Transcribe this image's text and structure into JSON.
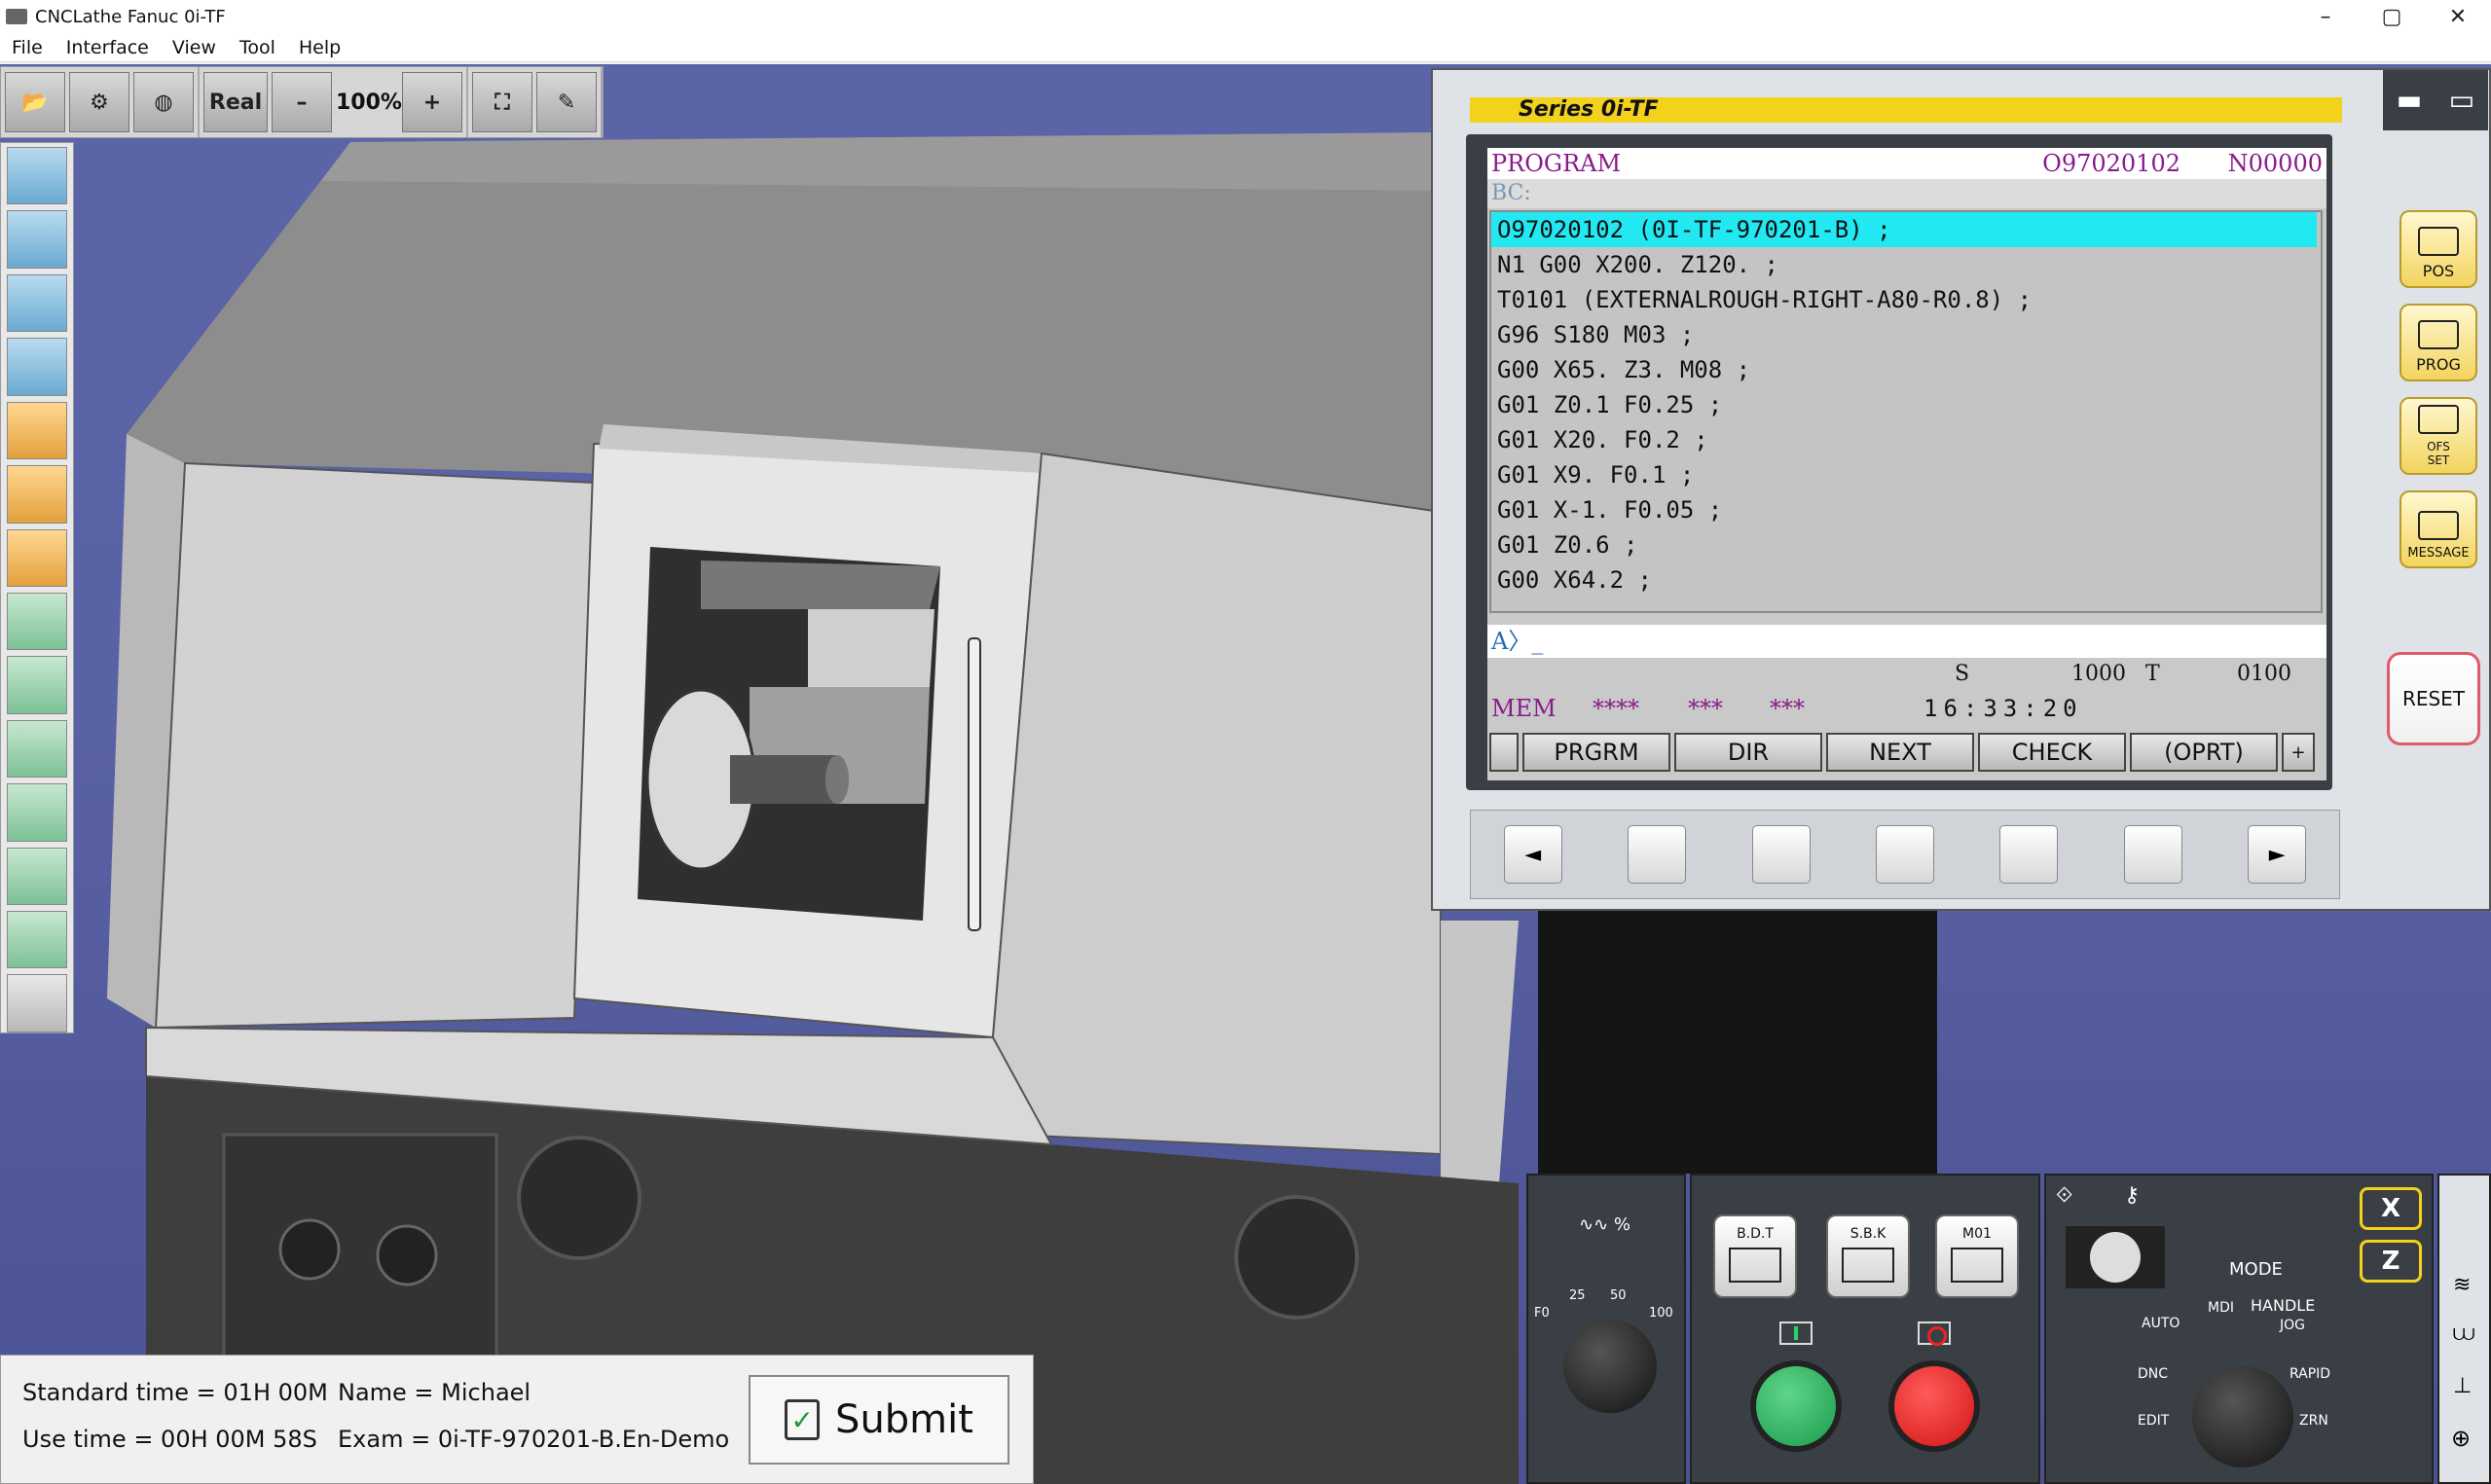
{
  "window": {
    "title": "CNCLathe Fanuc 0i-TF",
    "controls": [
      "–",
      "▢",
      "✕"
    ]
  },
  "menu": [
    "File",
    "Interface",
    "View",
    "Tool",
    "Help"
  ],
  "toolbar": {
    "real_label": "Real",
    "minus_label": "–",
    "zoom": "100%",
    "plus_label": "+"
  },
  "cnc": {
    "series": "Series 0i-TF",
    "screen_title": "PROGRAM",
    "program_no": "O97020102",
    "seq_no": "N00000",
    "bc_label": "BC:",
    "lines": [
      "O97020102 (0I-TF-970201-B) ;",
      "N1 G00 X200. Z120. ;",
      "T0101 (EXTERNALROUGH-RIGHT-A80-R0.8) ;",
      "G96 S180 M03 ;",
      "G00 X65. Z3. M08 ;",
      "G01 Z0.1 F0.25 ;",
      "G01 X20. F0.2 ;",
      "G01 X9. F0.1 ;",
      "G01 X-1. F0.05 ;",
      "G01 Z0.6 ;",
      "G00 X64.2 ;"
    ],
    "input_prompt": "A〉_",
    "status": {
      "s_label": "S",
      "s_value": "1000",
      "t_label": "T",
      "t_value": "0100"
    },
    "mode": {
      "mem": "MEM",
      "a": "****",
      "b": "***",
      "c": "***",
      "time": "16:33:20"
    },
    "softkeys": [
      "PRGRM",
      "DIR",
      "NEXT",
      "CHECK",
      "(OPRT)",
      "+"
    ],
    "keystrip": [
      "◄",
      "►"
    ],
    "side_buttons": [
      "POS",
      "PROG",
      "SET",
      "MESSAGE"
    ],
    "side_button_ofs": "OFS",
    "reset_label": "RESET",
    "panel_minmax": [
      "▬",
      "▭"
    ]
  },
  "info": {
    "standard_time": "Standard time = 01H 00M",
    "use_time": "Use time = 00H 00M 58S",
    "name": "Name = Michael",
    "exam": "Exam = 0i-TF-970201-B.En-Demo",
    "submit_label": "Submit"
  },
  "feed": {
    "label": "∿∿ %",
    "f0": "F0",
    "t25": "25",
    "t50": "50",
    "t100": "100"
  },
  "cycle": {
    "bdt": "B.D.T",
    "sbk": "S.B.K",
    "m01": "M01"
  },
  "mode_panel": {
    "mode": "MODE",
    "mdi": "MDI",
    "handle": "HANDLE",
    "auto": "AUTO",
    "jog": "JOG",
    "dnc": "DNC",
    "rapid": "RAPID",
    "edit": "EDIT",
    "zrn": "ZRN",
    "x": "X",
    "z": "Z"
  }
}
